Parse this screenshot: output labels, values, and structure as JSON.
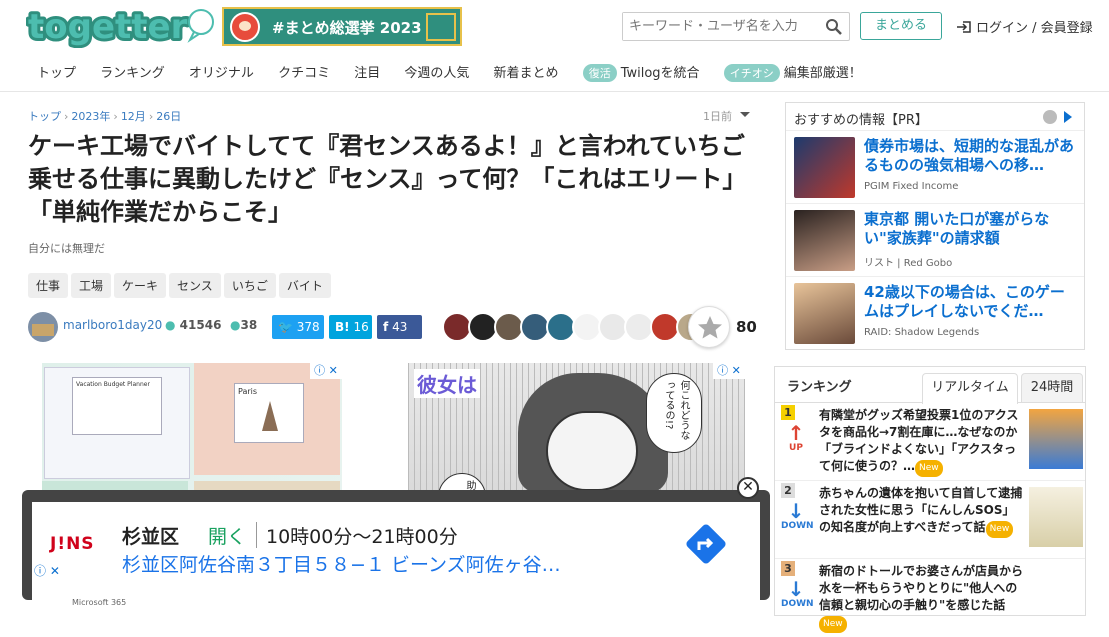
{
  "header": {
    "logo_text": "togetter",
    "banner_text": "#まとめ総選挙 2023",
    "search_placeholder": "キーワード・ユーザ名を入力",
    "matome_button": "まとめる",
    "login": "ログイン / 会員登録",
    "nav": [
      {
        "label": "トップ"
      },
      {
        "label": "ランキング"
      },
      {
        "label": "オリジナル"
      },
      {
        "label": "クチコミ"
      },
      {
        "label": "注目"
      },
      {
        "label": "今週の人気"
      },
      {
        "label": "新着まとめ"
      }
    ],
    "nav_pill_1": "復活",
    "nav_pill_1_label": "Twilogを統合",
    "nav_pill_2": "イチオシ",
    "nav_pill_2_label": "編集部厳選！"
  },
  "article": {
    "breadcrumb": [
      "トップ",
      "2023年",
      "12月",
      "26日"
    ],
    "posted_ago": "1日前",
    "title": "ケーキ工場でバイトしてて『君センスあるよ！』と言われていちご乗せる仕事に異動したけど『センス』って何？「これはエリート」「単純作業だからこそ」",
    "subtitle": "自分には無理だ",
    "tags": [
      "仕事",
      "工場",
      "ケーキ",
      "センス",
      "いちご",
      "バイト"
    ],
    "author": "marlboro1day20",
    "views": "41546",
    "comments": "38",
    "twitter_count": "378",
    "hatena_label": "B!",
    "hatena_count": "16",
    "facebook_label": "f",
    "facebook_count": "43",
    "favorite_count": "80"
  },
  "ads": {
    "ad1_title": "Vacation Budget Planner",
    "ad1_city": "Paris",
    "ad2_title": "彼女は",
    "ad2_bubble1": "何これどうなってるの!?",
    "ad2_bubble2": "助けお母父",
    "adchoice": "ⓘ ✕"
  },
  "sidebar": {
    "rec_header": "おすすめの情報【PR】",
    "rec_items": [
      {
        "title": "債券市場は、短期的な混乱があるものの強気相場への移…",
        "source": "PGIM Fixed Income",
        "color": "#1c3a6e"
      },
      {
        "title": "東京都 開いた口が塞がらない\"家族葬\"の請求額",
        "source": "リスト | Red Gobo",
        "color": "#4a3a33"
      },
      {
        "title": "42歳以下の場合は、このゲームはプレイしないでくだ…",
        "source": "RAID: Shadow Legends",
        "color": "#c99a6a"
      }
    ],
    "ranking_title": "ランキング",
    "tab_realtime": "リアルタイム",
    "tab_24h": "24時間",
    "ranking": [
      {
        "rank": "1",
        "dir": "UP",
        "arrow": "↑",
        "text": "有隣堂がグッズ希望投票1位のアクスタを商品化→7割在庫に…なぜなのか「ブラインドよくない」「アクスタって何に使うの？…",
        "badge": "New",
        "color": "#d43"
      },
      {
        "rank": "2",
        "dir": "DOWN",
        "arrow": "↓",
        "text": "赤ちゃんの遺体を抱いて自首して逮捕された女性に思う「にんしんSOS」の知名度が向上すべきだって話",
        "badge": "New",
        "color": "#2a7ad4"
      },
      {
        "rank": "3",
        "dir": "DOWN",
        "arrow": "↓",
        "text": "新宿のドトールでお婆さんが店員から水を一杯もらうやりとりに\"他人への信頼と親切心の手触り\"を感じた話",
        "badge": "New",
        "color": "#2a7ad4"
      }
    ]
  },
  "popup": {
    "brand": "J!NS",
    "store": "杉並区",
    "status": "開く",
    "hours": "10時00分〜21時00分",
    "address": "杉並区阿佐谷南３丁目５８−１ ビーンズ阿佐ヶ谷…",
    "adchoice": "ⓘ ✕",
    "bottom_text": "Microsoft 365",
    "close": "✕"
  }
}
